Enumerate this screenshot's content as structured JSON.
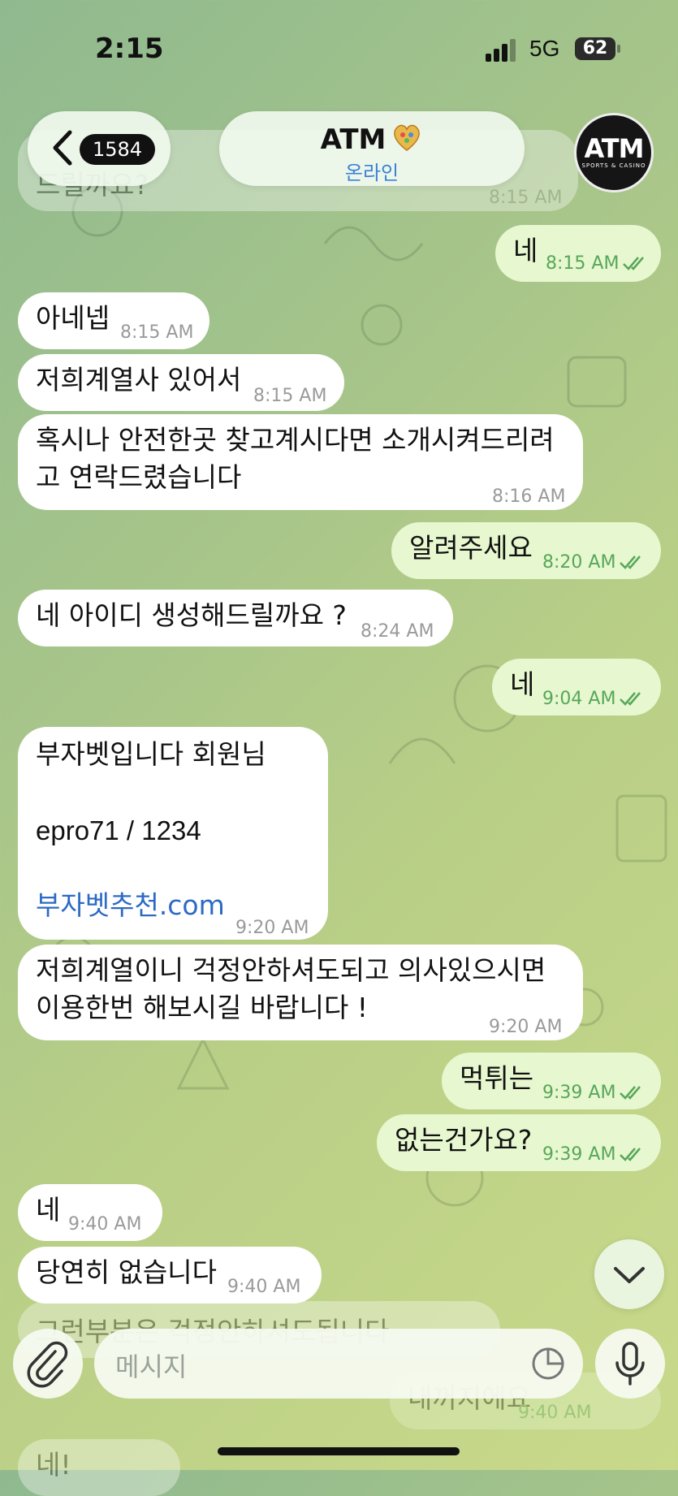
{
  "status": {
    "time": "2:15",
    "network": "5G",
    "battery": "62"
  },
  "header": {
    "back_count": "1584",
    "title": "ATM",
    "subtitle": "온라인",
    "avatar_text": "ATM",
    "avatar_sub": "SPORTS & CASINO"
  },
  "messages": [
    {
      "dir": "in",
      "text": "드릴까요?",
      "time": "8:15 AM"
    },
    {
      "dir": "out",
      "text": "네",
      "time": "8:15 AM"
    },
    {
      "dir": "in",
      "text": "아네넵",
      "time": "8:15 AM"
    },
    {
      "dir": "in",
      "text": "저희계열사 있어서",
      "time": "8:15 AM"
    },
    {
      "dir": "in",
      "line1": "혹시나 안전한곳 찾고계시다면 소개시켜드리려",
      "line2": "고 연락드렸습니다",
      "time": "8:16 AM"
    },
    {
      "dir": "out",
      "text": "알려주세요",
      "time": "8:20 AM"
    },
    {
      "dir": "in",
      "text": "네 아이디 생성해드릴까요 ?",
      "time": "8:24 AM"
    },
    {
      "dir": "out",
      "text": "네",
      "time": "9:04 AM"
    },
    {
      "dir": "in",
      "line1": "부자벳입니다 회원님",
      "line2": "epro71   /   1234",
      "link": "부자벳추천.com",
      "time": "9:20 AM"
    },
    {
      "dir": "in",
      "line1": "저희계열이니 걱정안하셔도되고 의사있으시면",
      "line2": "이용한번 해보시길 바랍니다 !",
      "time": "9:20 AM"
    },
    {
      "dir": "out",
      "text": "먹튀는",
      "time": "9:39 AM"
    },
    {
      "dir": "out",
      "text": "없는건가요?",
      "time": "9:39 AM"
    },
    {
      "dir": "in",
      "text": "네",
      "time": "9:40 AM"
    },
    {
      "dir": "in",
      "text": "당연히 없습니다",
      "time": "9:40 AM"
    },
    {
      "dir": "in",
      "text": "그런부분은 걱정안하셔도됩니다",
      "time": ""
    },
    {
      "dir": "out",
      "text": "내꺼지에요",
      "time": "9:40 AM"
    },
    {
      "dir": "in",
      "text": "네!",
      "time": ""
    }
  ],
  "composer": {
    "placeholder": "메시지"
  },
  "colors": {
    "incoming": "#ffffff",
    "outgoing": "#e7f7cf",
    "read_check": "#57a75a",
    "accent": "#3b82d8"
  }
}
